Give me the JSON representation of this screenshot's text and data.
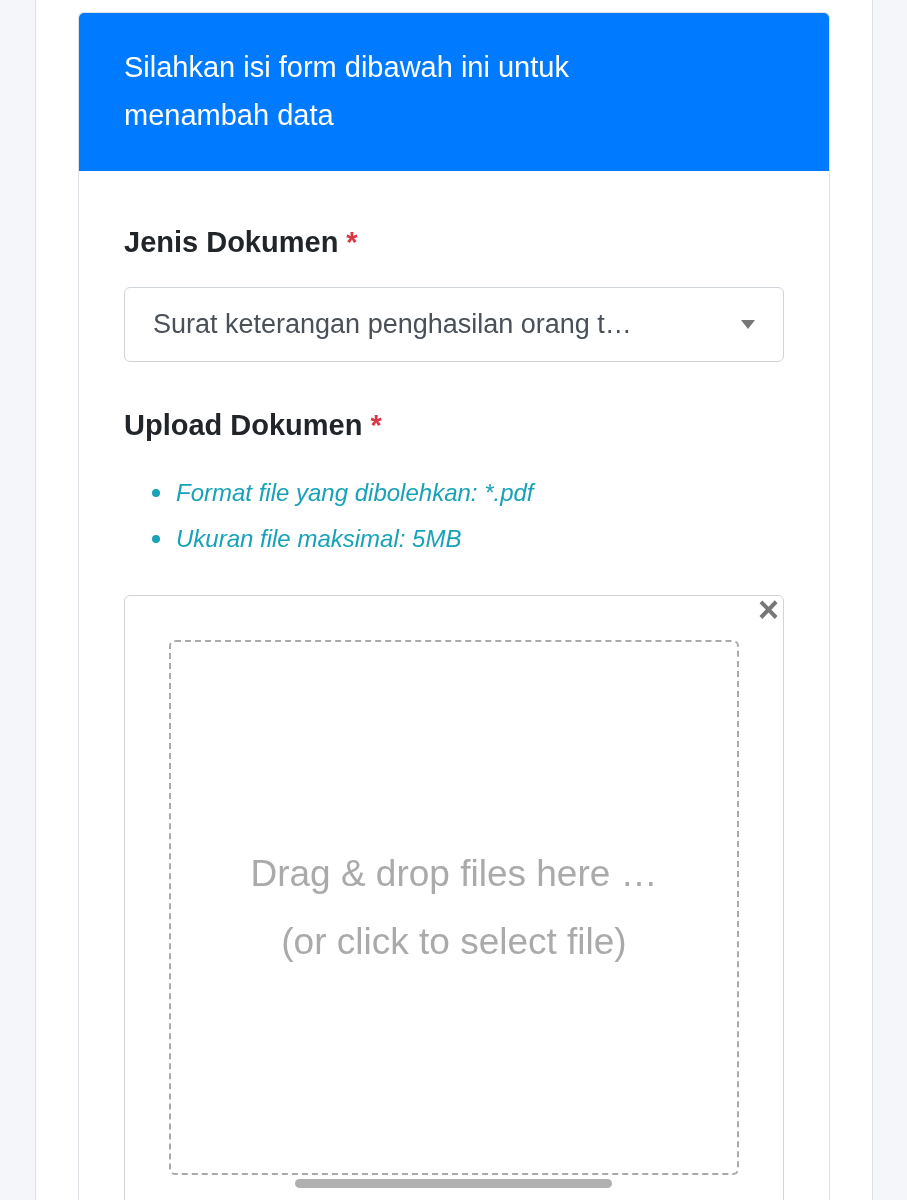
{
  "header": {
    "text": "Silahkan isi form dibawah ini untuk menambah data"
  },
  "document_type": {
    "label": "Jenis Dokumen",
    "required_mark": "*",
    "value": "Surat keterangan penghasilan orang t…"
  },
  "upload": {
    "label": "Upload Dokumen",
    "required_mark": "*",
    "rules": [
      "Format file yang dibolehkan: *.pdf",
      "Ukuran file maksimal: 5MB"
    ],
    "close": "×",
    "dropzone_lines": [
      "Drag & drop files here …",
      "(or click to select file)"
    ]
  }
}
